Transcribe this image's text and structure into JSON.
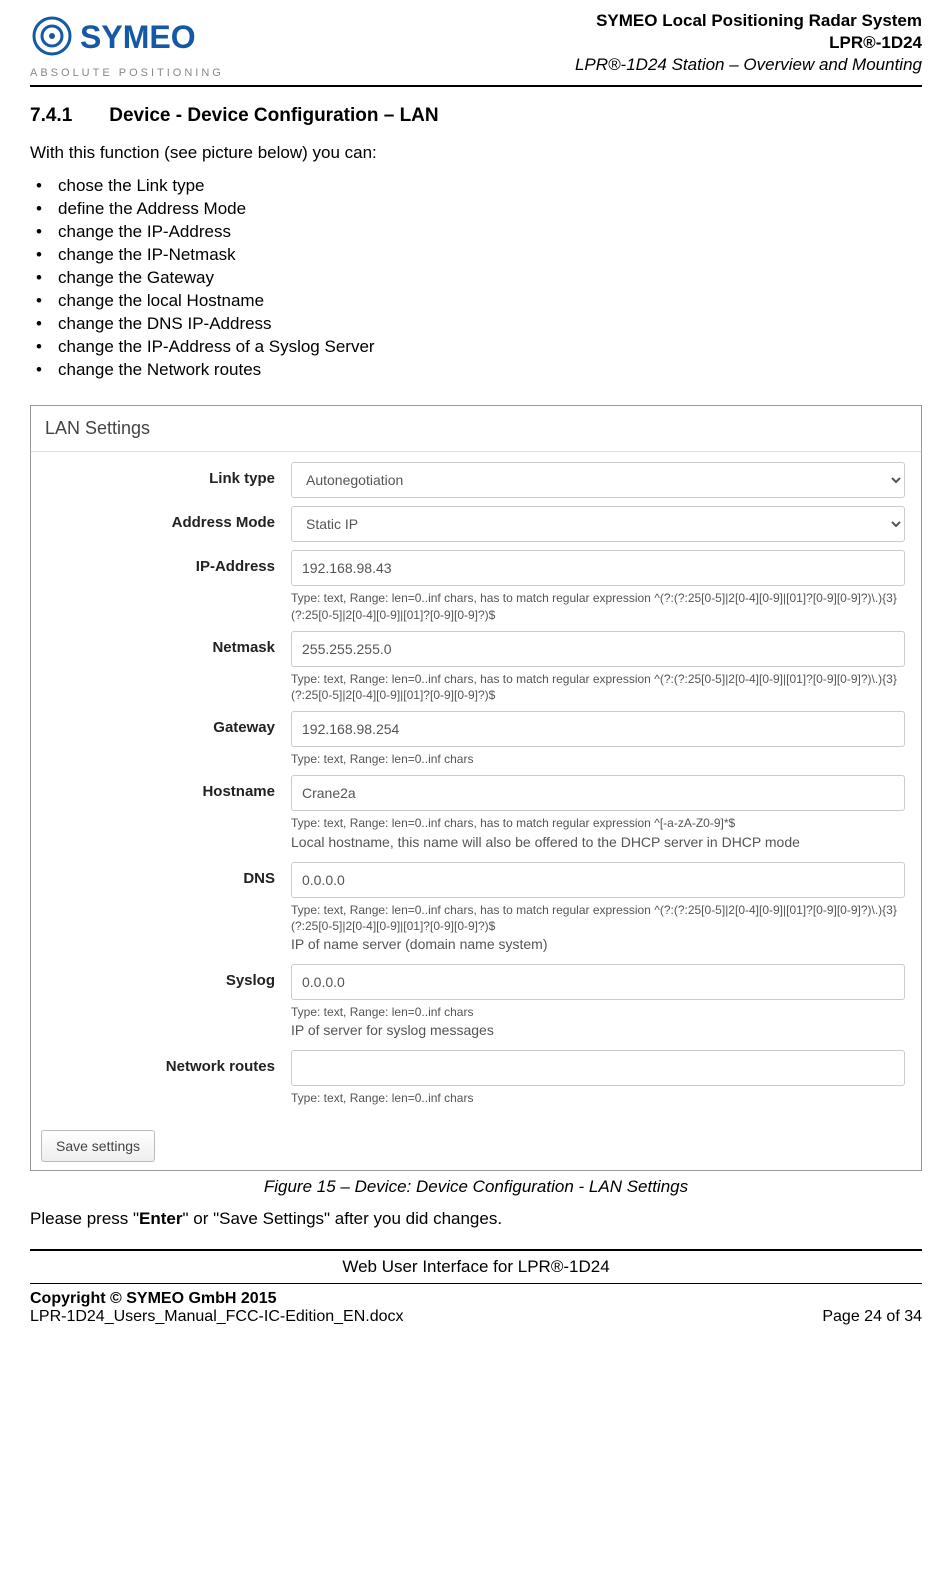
{
  "header": {
    "logo_tagline": "ABSOLUTE POSITIONING",
    "line1": "SYMEO Local Positioning Radar System",
    "line2": "LPR®-1D24",
    "line3": "LPR®-1D24 Station – Overview and Mounting"
  },
  "section": {
    "number": "7.4.1",
    "title": "Device - Device Configuration – LAN",
    "intro": "With this function (see picture below) you can:",
    "bullets": [
      "chose the Link type",
      "define the Address Mode",
      "change the IP-Address",
      "change the IP-Netmask",
      "change the Gateway",
      "change the local Hostname",
      "change the DNS IP-Address",
      "change the IP-Address of a Syslog Server",
      "change the Network routes"
    ]
  },
  "form": {
    "panel_title": "LAN Settings",
    "link_type": {
      "label": "Link type",
      "value": "Autonegotiation"
    },
    "address_mode": {
      "label": "Address Mode",
      "value": "Static IP"
    },
    "ip_address": {
      "label": "IP-Address",
      "value": "192.168.98.43",
      "help": "Type: text, Range: len=0..inf chars, has to match regular expression ^(?:(?:25[0-5]|2[0-4][0-9]|[01]?[0-9][0-9]?)\\.){3}(?:25[0-5]|2[0-4][0-9]|[01]?[0-9][0-9]?)$"
    },
    "netmask": {
      "label": "Netmask",
      "value": "255.255.255.0",
      "help": "Type: text, Range: len=0..inf chars, has to match regular expression ^(?:(?:25[0-5]|2[0-4][0-9]|[01]?[0-9][0-9]?)\\.){3}(?:25[0-5]|2[0-4][0-9]|[01]?[0-9][0-9]?)$"
    },
    "gateway": {
      "label": "Gateway",
      "value": "192.168.98.254",
      "help": "Type: text, Range: len=0..inf chars"
    },
    "hostname": {
      "label": "Hostname",
      "value": "Crane2a",
      "help": "Type: text, Range: len=0..inf chars, has to match regular expression ^[-a-zA-Z0-9]*$",
      "desc": "Local hostname, this name will also be offered to the DHCP server in DHCP mode"
    },
    "dns": {
      "label": "DNS",
      "value": "0.0.0.0",
      "help": "Type: text, Range: len=0..inf chars, has to match regular expression ^(?:(?:25[0-5]|2[0-4][0-9]|[01]?[0-9][0-9]?)\\.){3}(?:25[0-5]|2[0-4][0-9]|[01]?[0-9][0-9]?)$",
      "desc": "IP of name server (domain name system)"
    },
    "syslog": {
      "label": "Syslog",
      "value": "0.0.0.0",
      "help": "Type: text, Range: len=0..inf chars",
      "desc": "IP of server for syslog messages"
    },
    "network_routes": {
      "label": "Network routes",
      "value": "",
      "help": "Type: text, Range: len=0..inf chars"
    },
    "save_button": "Save settings"
  },
  "caption": "Figure 15 – Device: Device Configuration - LAN Settings",
  "post_text": {
    "pre": "Please press \"",
    "bold": "Enter",
    "post": "\" or \"Save Settings\" after you did changes."
  },
  "footer": {
    "mid": "Web User Interface for LPR®-1D24",
    "copyright": "Copyright © SYMEO GmbH 2015",
    "filename": "LPR-1D24_Users_Manual_FCC-IC-Edition_EN.docx",
    "page": "Page 24 of 34"
  }
}
